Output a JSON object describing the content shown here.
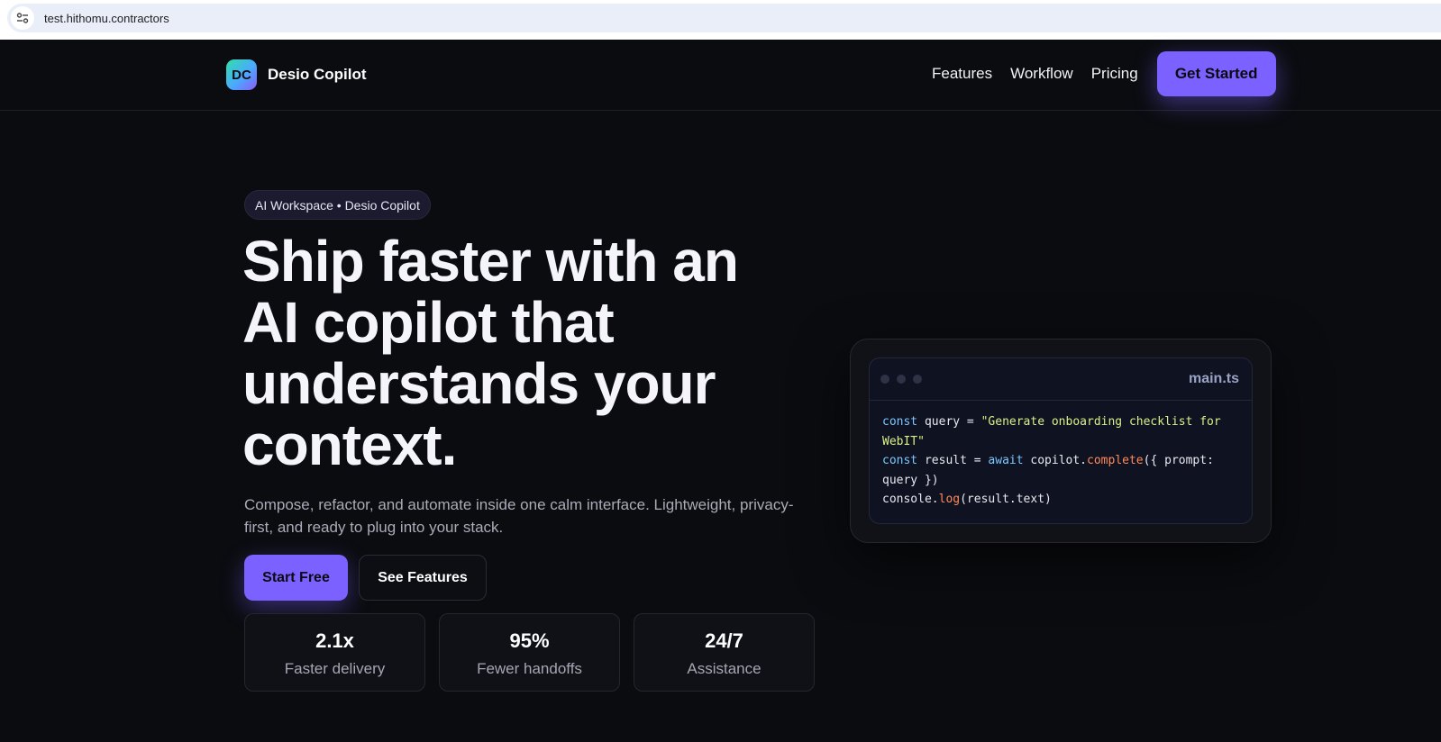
{
  "browser": {
    "url": "test.hithomu.contractors"
  },
  "brand": {
    "logo_text": "DC",
    "name": "Desio Copilot"
  },
  "nav": {
    "links": [
      "Features",
      "Workflow",
      "Pricing"
    ],
    "cta": "Get Started"
  },
  "hero": {
    "eyebrow": "AI Workspace • Desio Copilot",
    "title_lines": [
      "Ship faster with an",
      "AI copilot that",
      "understands your",
      "context."
    ],
    "subtitle": "Compose, refactor, and automate inside one calm interface. Lightweight, privacy-first, and ready to plug into your stack.",
    "primary_button": "Start Free",
    "secondary_button": "See Features"
  },
  "stats": [
    {
      "value": "2.1x",
      "label": "Faster delivery"
    },
    {
      "value": "95%",
      "label": "Fewer handoffs"
    },
    {
      "value": "24/7",
      "label": "Assistance"
    }
  ],
  "code": {
    "file_name": "main.ts",
    "line1_kw": "const",
    "line1_var": " query = ",
    "line1_str": "\"Generate onboarding checklist for WebIT\"",
    "line2_kw": "const",
    "line2_var": " result = ",
    "line2_kw2": "await",
    "line2_obj": " copilot.",
    "line2_fn": "complete",
    "line2_rest": "({ prompt: query })",
    "line3_obj": "console.",
    "line3_fn": "log",
    "line3_rest": "(result.text)"
  },
  "colors": {
    "accent": "#7b61ff",
    "background": "#0b0c10"
  }
}
